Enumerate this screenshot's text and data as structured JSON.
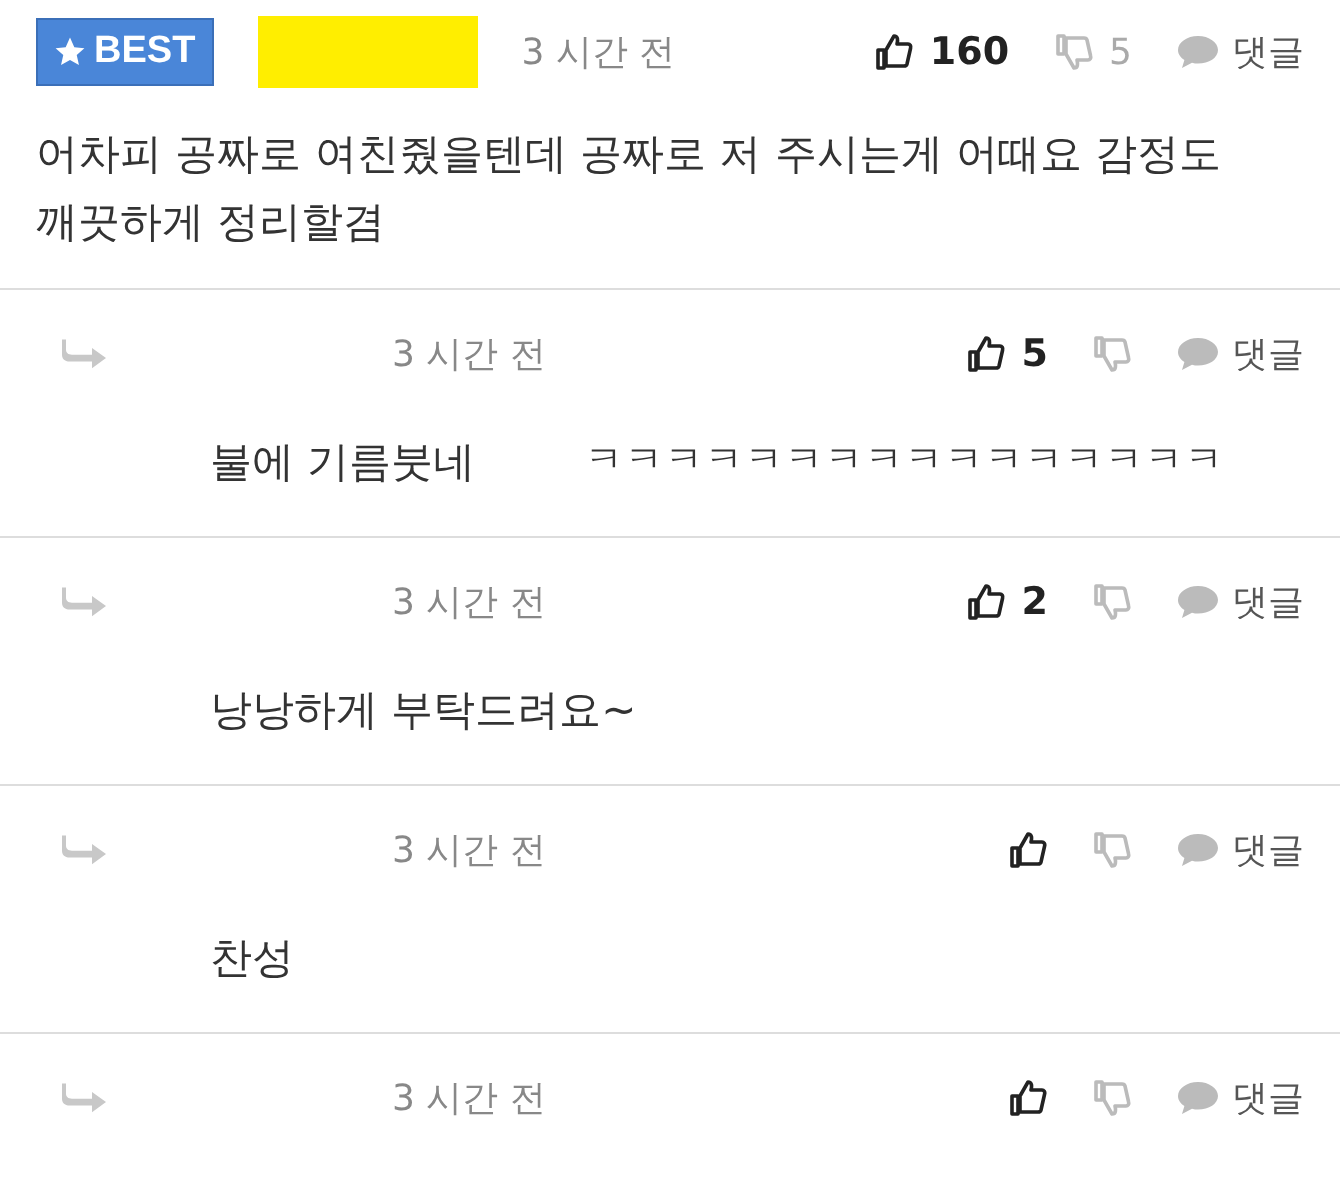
{
  "best_comment": {
    "badge": "BEST",
    "time": "3 시간 전",
    "likes": "160",
    "dislikes": "5",
    "reply_label": "댓글",
    "text": "어차피 공짜로 여친줬을텐데 공짜로 저 주시는게 어때요 감정도 깨끗하게 정리할겸"
  },
  "replies": [
    {
      "time": "3 시간 전",
      "likes": "5",
      "reply_label": "댓글",
      "text": "불에 기름붓네",
      "extra": "ㅋㅋㅋㅋㅋㅋㅋㅋㅋㅋㅋㅋㅋㅋㅋㅋ"
    },
    {
      "time": "3 시간 전",
      "likes": "2",
      "reply_label": "댓글",
      "text": "낭낭하게 부탁드려요~"
    },
    {
      "time": "3 시간 전",
      "reply_label": "댓글",
      "text": "찬성"
    },
    {
      "time": "3 시간 전",
      "reply_label": "댓글"
    }
  ]
}
